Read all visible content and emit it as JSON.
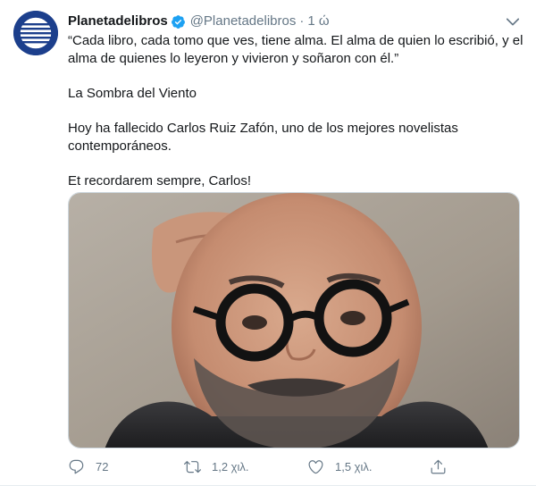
{
  "tweet": {
    "author_name": "Planetadelibros",
    "handle": "@Planetadelibros",
    "separator": "·",
    "time": "1 ώ",
    "paragraphs": [
      "“Cada libro, cada tomo que ves, tiene alma. El alma de quien lo escribió, y el alma de quienes lo leyeron y vivieron y soñaron con él.”",
      "La Sombra del Viento",
      "Hoy ha fallecido Carlos Ruiz Zafón, uno de los mejores novelistas contemporáneos.",
      "Et recordarem sempre, Carlos!"
    ],
    "actions": {
      "reply_count": "72",
      "retweet_count": "1,2 χιλ.",
      "like_count": "1,5 χιλ."
    }
  },
  "icons": {
    "avatar": "planeta-globe-logo",
    "verified": "verified-badge-icon",
    "caret": "chevron-down-icon",
    "reply": "reply-icon",
    "retweet": "retweet-icon",
    "like": "heart-icon",
    "share": "share-icon"
  },
  "colors": {
    "text": "#14171a",
    "secondary": "#657786",
    "verified": "#1da1f2",
    "avatar_blue": "#1c3f8c"
  }
}
